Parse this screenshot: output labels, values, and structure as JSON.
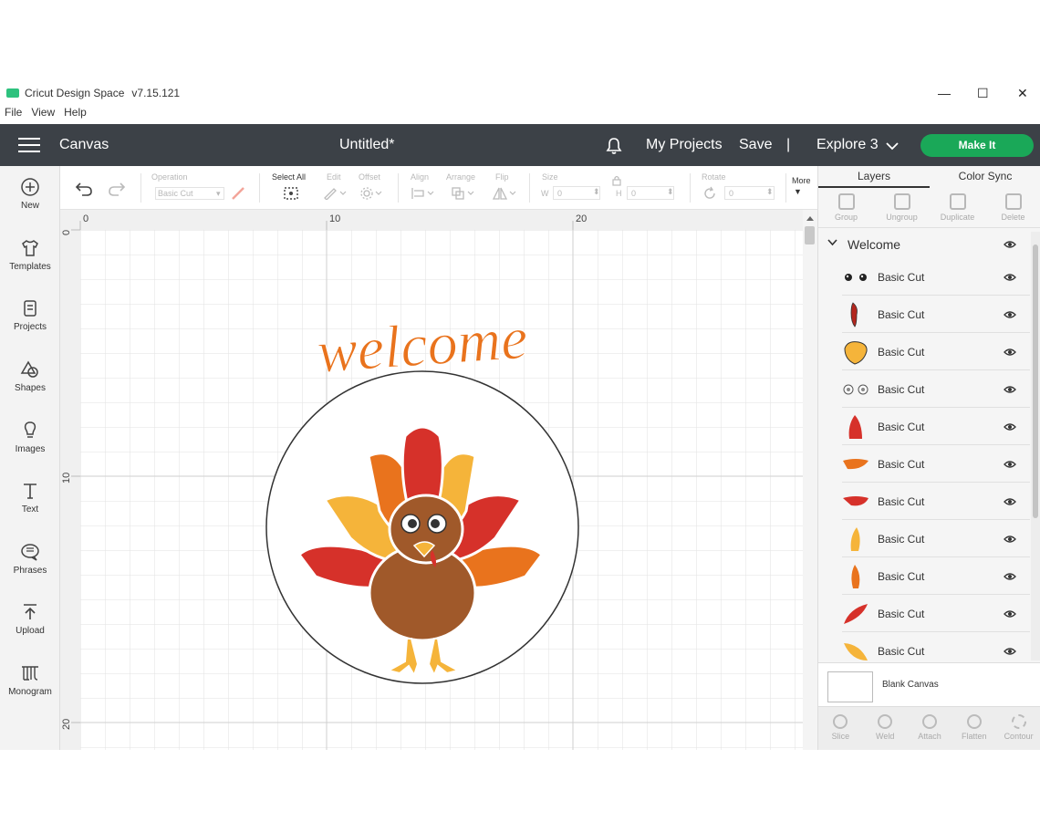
{
  "titlebar": {
    "app_name": "Cricut Design Space",
    "version": "v7.15.121",
    "minimize": "—",
    "maximize": "☐",
    "close": "✕"
  },
  "menu": {
    "file": "File",
    "view": "View",
    "help": "Help"
  },
  "header": {
    "section": "Canvas",
    "doc_title": "Untitled*",
    "my_projects": "My Projects",
    "save": "Save",
    "separator": "|",
    "machine": "Explore 3",
    "make_it": "Make It"
  },
  "sidebar": {
    "items": [
      {
        "label": "New",
        "icon": "plus-circle-icon"
      },
      {
        "label": "Templates",
        "icon": "shirt-icon"
      },
      {
        "label": "Projects",
        "icon": "projects-icon"
      },
      {
        "label": "Shapes",
        "icon": "shapes-icon"
      },
      {
        "label": "Images",
        "icon": "lightbulb-icon"
      },
      {
        "label": "Text",
        "icon": "text-icon"
      },
      {
        "label": "Phrases",
        "icon": "speech-bubble-icon"
      },
      {
        "label": "Upload",
        "icon": "upload-icon"
      },
      {
        "label": "Monogram",
        "icon": "monogram-icon"
      }
    ]
  },
  "toolbar": {
    "operation_label": "Operation",
    "operation_value": "Basic Cut",
    "select_all": "Select All",
    "edit": "Edit",
    "offset": "Offset",
    "align": "Align",
    "arrange": "Arrange",
    "flip": "Flip",
    "size": "Size",
    "w_label": "W",
    "w_value": "0",
    "h_label": "H",
    "h_value": "0",
    "rotate": "Rotate",
    "rotate_value": "0",
    "more": "More"
  },
  "ruler": {
    "top": [
      "0",
      "10",
      "20"
    ],
    "left": [
      "0",
      "10",
      "20"
    ]
  },
  "artwork": {
    "text": "welcome",
    "colors": {
      "orange": "#e9731d",
      "red": "#d6312a",
      "yellow": "#f5b43a",
      "brown": "#a0592a",
      "dark": "#333333"
    }
  },
  "right_panel": {
    "tabs": {
      "layers": "Layers",
      "color_sync": "Color Sync"
    },
    "tools": {
      "group": "Group",
      "ungroup": "Ungroup",
      "duplicate": "Duplicate",
      "delete": "Delete"
    },
    "group_name": "Welcome",
    "layers": [
      {
        "label": "Basic Cut",
        "thumb": "eyes"
      },
      {
        "label": "Basic Cut",
        "thumb": "wattle"
      },
      {
        "label": "Basic Cut",
        "thumb": "beak"
      },
      {
        "label": "Basic Cut",
        "thumb": "eye-whites"
      },
      {
        "label": "Basic Cut",
        "thumb": "red-feather"
      },
      {
        "label": "Basic Cut",
        "thumb": "orange-feather"
      },
      {
        "label": "Basic Cut",
        "thumb": "red-wing"
      },
      {
        "label": "Basic Cut",
        "thumb": "yellow-feather"
      },
      {
        "label": "Basic Cut",
        "thumb": "orange-feather-2"
      },
      {
        "label": "Basic Cut",
        "thumb": "red-feather-2"
      },
      {
        "label": "Basic Cut",
        "thumb": "yellow-feather-2"
      }
    ],
    "blank_canvas": "Blank Canvas",
    "bottom_tools": {
      "slice": "Slice",
      "weld": "Weld",
      "attach": "Attach",
      "flatten": "Flatten",
      "contour": "Contour"
    }
  }
}
